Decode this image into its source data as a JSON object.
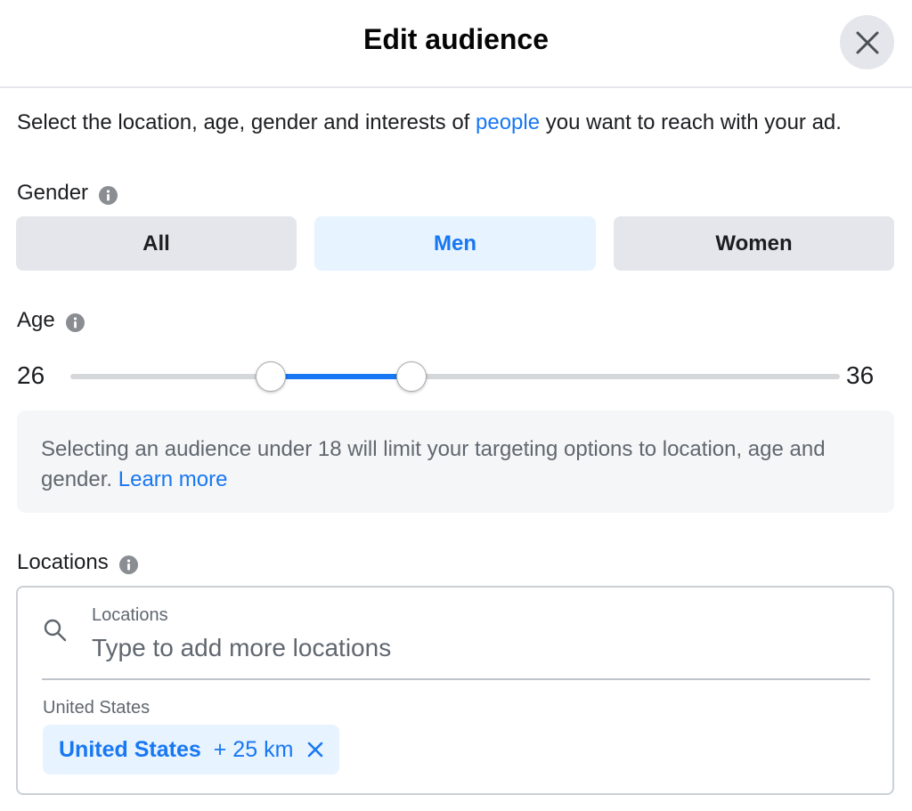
{
  "header": {
    "title": "Edit audience",
    "close_icon": "close-icon"
  },
  "intro": {
    "text_before": "Select the location, age, gender and interests of ",
    "link": "people",
    "text_after": " you want to reach with your ad."
  },
  "gender": {
    "label": "Gender",
    "options": [
      "All",
      "Men",
      "Women"
    ],
    "selected": "Men"
  },
  "age": {
    "label": "Age",
    "min": "26",
    "max": "36"
  },
  "notice": {
    "text": "Selecting an audience under 18 will limit your targeting options to location, age and gender. ",
    "link": "Learn more"
  },
  "locations": {
    "label": "Locations",
    "field_label": "Locations",
    "placeholder": "Type to add more locations",
    "group_label": "United States",
    "chip": {
      "name": "United States",
      "radius": "+ 25 km"
    }
  },
  "colors": {
    "accent": "#1877f2",
    "selected_bg": "#e7f3ff",
    "neutral_bg": "#e4e6eb"
  }
}
